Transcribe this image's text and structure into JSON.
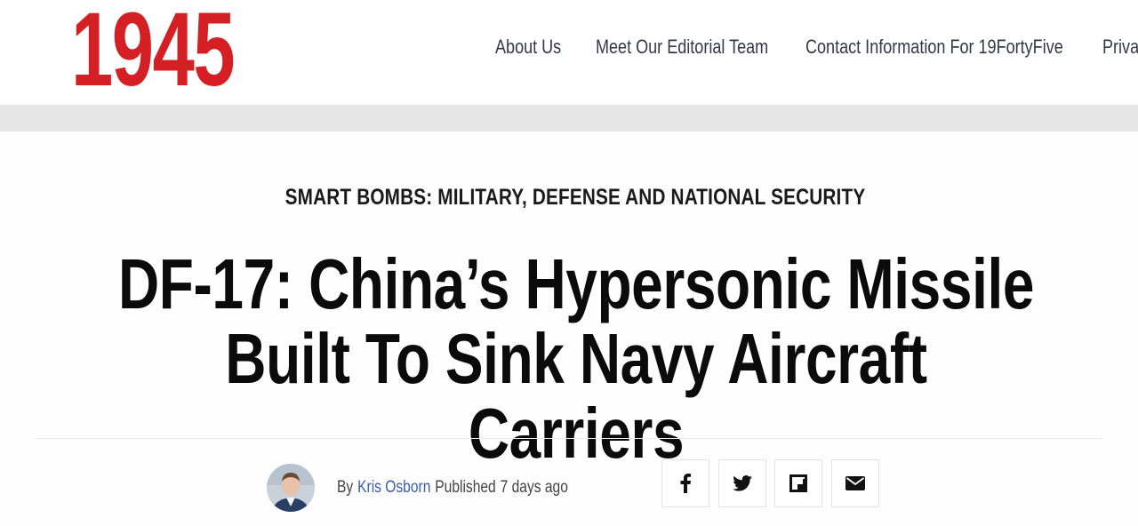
{
  "site": {
    "logo_text": "1945",
    "brand_color": "#d42024"
  },
  "nav": {
    "items": [
      {
        "label": "About Us"
      },
      {
        "label": "Meet Our Editorial Team"
      },
      {
        "label": "Contact Information For 19FortyFive"
      },
      {
        "label": "Priva"
      }
    ]
  },
  "article": {
    "category": "SMART BOMBS: MILITARY, DEFENSE AND NATIONAL SECURITY",
    "headline_line1": "DF-17: China’s Hypersonic Missile",
    "headline_line2": "Built To Sink Navy Aircraft Carriers",
    "byline": {
      "by": "By",
      "author": "Kris Osborn",
      "published_label": "Published",
      "published_time": "7 days ago"
    },
    "share": [
      {
        "icon": "facebook-icon"
      },
      {
        "icon": "twitter-icon"
      },
      {
        "icon": "flipboard-icon"
      },
      {
        "icon": "email-icon"
      }
    ]
  }
}
